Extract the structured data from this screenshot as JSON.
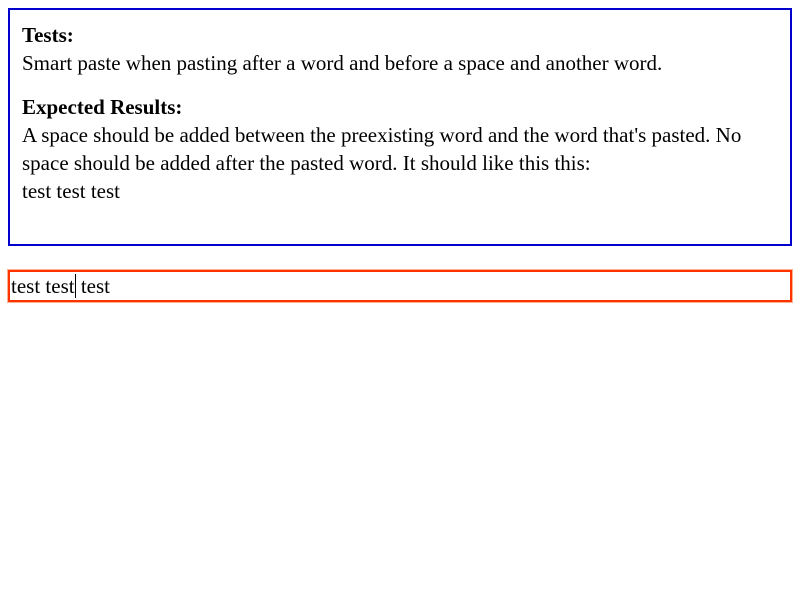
{
  "instructions": {
    "tests_heading": "Tests:",
    "tests_text": "Smart paste when pasting after a word and before a space and another word.",
    "expected_heading": "Expected Results:",
    "expected_text": "A space should be added between the preexisting word and the word that's pasted. No space should be added after the pasted word. It should like this this:",
    "expected_sample": "test test test"
  },
  "editor": {
    "text_before_caret": "test test",
    "text_after_caret": " test"
  },
  "colors": {
    "instructions_border": "#0000cc",
    "editor_border": "#ff3300"
  }
}
